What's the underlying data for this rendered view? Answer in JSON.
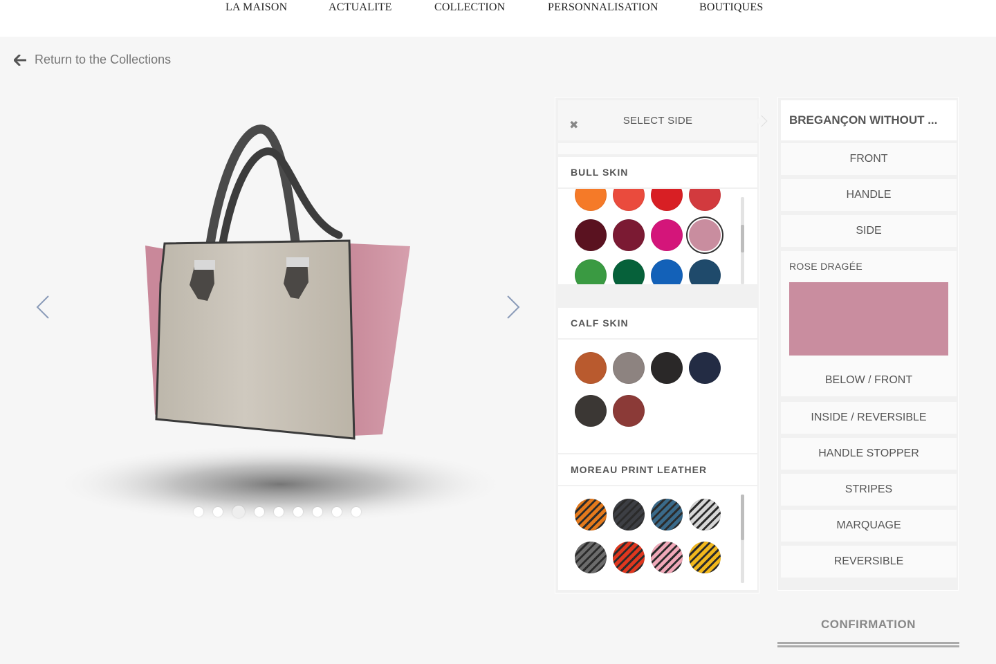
{
  "nav": {
    "items": [
      "LA MAISON",
      "ACTUALITE",
      "COLLECTION",
      "PERSONNALISATION",
      "BOUTIQUES"
    ]
  },
  "back_link": {
    "label": "Return to the Collections",
    "icon": "arrow-left-icon"
  },
  "carousel": {
    "slide_count": 9,
    "active_index": 2
  },
  "material_panel": {
    "header": "SELECT SIDE",
    "groups": [
      {
        "title": "BULL SKIN",
        "swatches": [
          "#f57a28",
          "#ea4b3d",
          "#d81f24",
          "#d23a3e",
          "#5a1220",
          "#7b1a33",
          "#d4157a",
          "#c98d9f",
          "#3a9a42",
          "#06613a",
          "#1361b8",
          "#1f4a6b"
        ],
        "selected": 7
      },
      {
        "title": "CALF SKIN",
        "swatches": [
          "#b95a2e",
          "#8d8380",
          "#2a2828",
          "#232c44",
          "#3b3734",
          "#8b3a37"
        ]
      },
      {
        "title": "MOREAU PRINT LEATHER",
        "swatches": [
          "#e57a1c",
          "#3d3f44",
          "#3a6a8a",
          "#d6d6d6",
          "#6c6c6c",
          "#e0371f",
          "#f0a8b8",
          "#f2b81c"
        ]
      }
    ]
  },
  "parts_panel": {
    "title": "BREGANÇON WITHOUT ...",
    "parts_top": [
      "FRONT",
      "HANDLE",
      "SIDE"
    ],
    "selected_material": "ROSE DRAGÉE",
    "selected_color": "#c98d9f",
    "selected_part": "BELOW / FRONT",
    "parts_bottom": [
      "INSIDE / REVERSIBLE",
      "HANDLE STOPPER",
      "STRIPES",
      "MARQUAGE",
      "REVERSIBLE"
    ]
  },
  "confirm": {
    "label": "CONFIRMATION"
  }
}
